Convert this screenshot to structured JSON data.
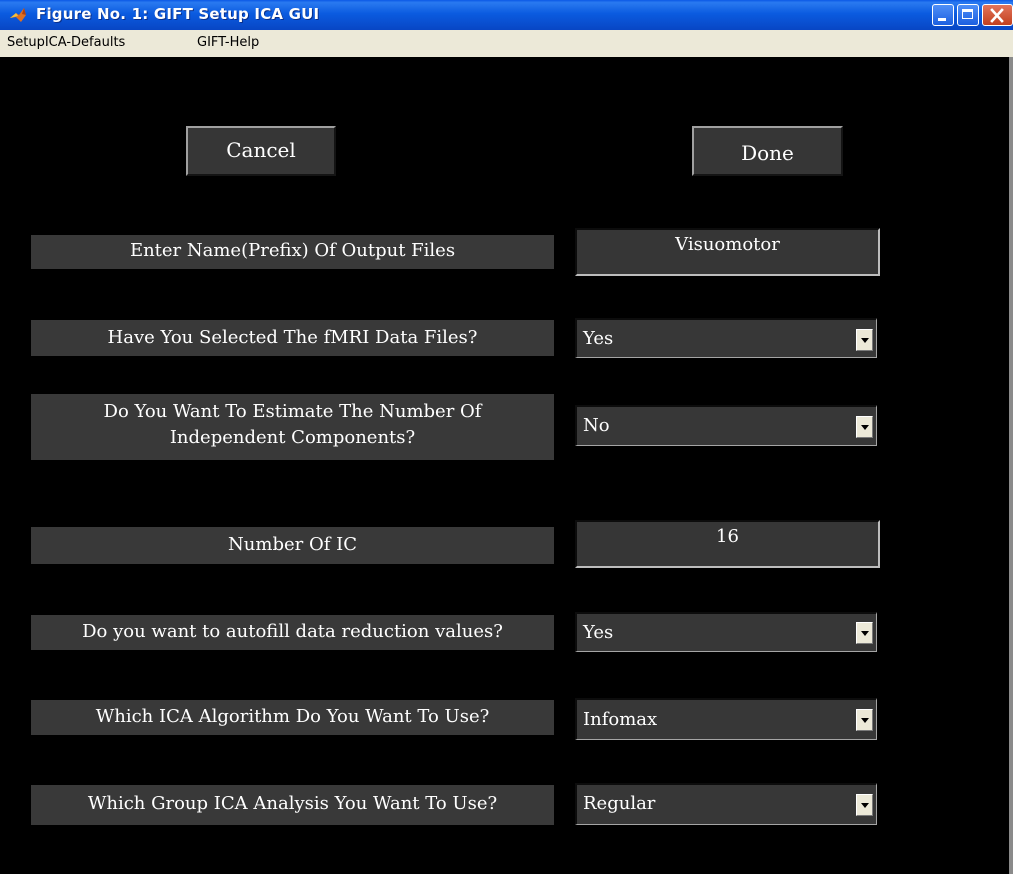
{
  "window": {
    "title": "Figure No. 1: GIFT Setup ICA GUI",
    "icon": "matlab-logo-icon",
    "controls": [
      "minimize-icon",
      "maximize-icon",
      "close-icon"
    ]
  },
  "menubar": {
    "items": [
      "SetupICA-Defaults",
      "GIFT-Help"
    ]
  },
  "buttons": {
    "cancel": "Cancel",
    "done": "Done"
  },
  "form": {
    "output_prefix": {
      "label": "Enter Name(Prefix) Of Output Files",
      "value": "Visuomotor"
    },
    "fmri_selected": {
      "label": "Have You Selected The fMRI Data Files?",
      "value": "Yes"
    },
    "estimate_components": {
      "label_line1": "Do You Want To Estimate The Number Of",
      "label_line2": "Independent Components?",
      "value": "No"
    },
    "number_of_ic": {
      "label": "Number Of IC",
      "value": "16"
    },
    "autofill": {
      "label": "Do you want to autofill data reduction values?",
      "value": "Yes"
    },
    "algorithm": {
      "label": "Which ICA Algorithm Do You Want To Use?",
      "value": "Infomax"
    },
    "group_analysis": {
      "label": "Which Group ICA Analysis You Want To Use?",
      "value": "Regular"
    }
  },
  "colors": {
    "background": "#000000",
    "control_face": "#363636",
    "titlebar": "#0b5be0",
    "menubar": "#ece9d8",
    "text": "#ffffff"
  }
}
